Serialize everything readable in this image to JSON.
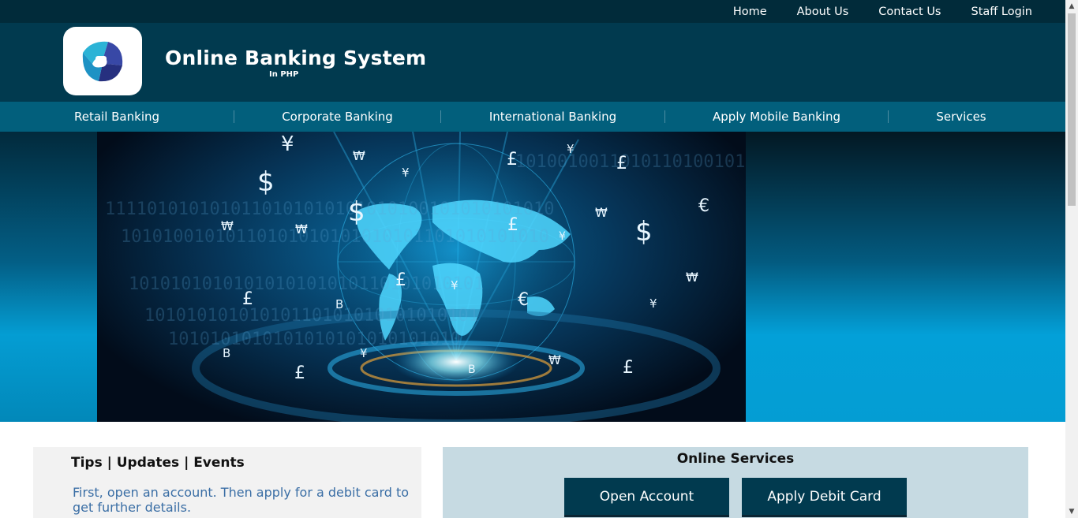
{
  "topnav": {
    "items": [
      "Home",
      "About Us",
      "Contact Us",
      "Staff Login"
    ]
  },
  "header": {
    "title": "Online Banking System",
    "subtitle": "In PHP",
    "logo_icon": "bank-logo-icon"
  },
  "mainnav": {
    "items": [
      "Retail Banking",
      "Corporate Banking",
      "International Banking",
      "Apply Mobile Banking",
      "Services"
    ]
  },
  "hero": {
    "symbols": [
      "¥",
      "₩",
      "$",
      "¥",
      "£",
      "¥",
      "£",
      "$",
      "₩",
      "€",
      "₩",
      "₩",
      "£",
      "¥",
      "$",
      "£",
      "¥",
      "€",
      "₩",
      "¥",
      "£",
      "B",
      "B",
      "¥",
      "£",
      "B",
      "₩",
      "£"
    ]
  },
  "tips": {
    "title": "Tips | Updates | Events",
    "text": "First, open an account. Then apply for a debit card to get further details."
  },
  "services": {
    "title": "Online Services",
    "buttons": [
      "Open Account",
      "Apply Debit Card"
    ]
  },
  "colors": {
    "topbar": "#012b3a",
    "header": "#013a4f",
    "nav": "#025f7c",
    "services_panel": "#c6dae2",
    "tips_text": "#3a6ea5"
  }
}
